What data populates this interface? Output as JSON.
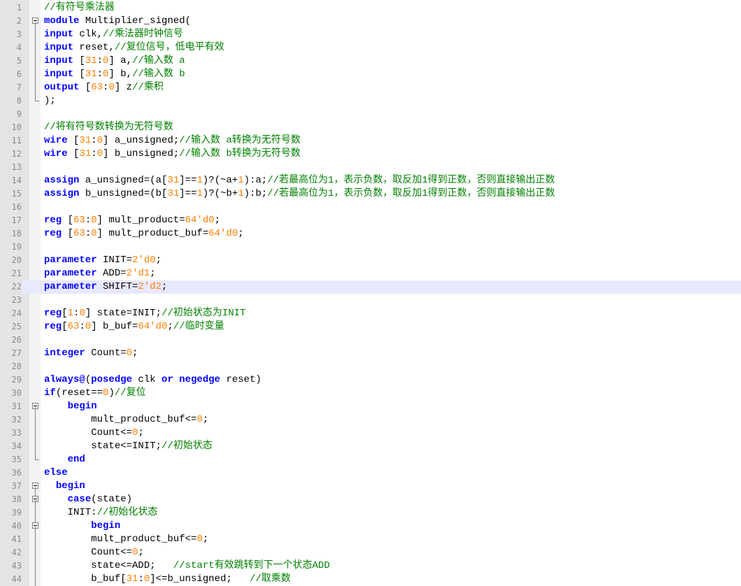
{
  "editor": {
    "current_line": 22,
    "lines": [
      {
        "n": "1",
        "fold": "",
        "tokens": [
          [
            "cm",
            "//有符号乘法器"
          ]
        ]
      },
      {
        "n": "2",
        "fold": "start",
        "tokens": [
          [
            "kw",
            "module"
          ],
          [
            "tx",
            " Multiplier_signed("
          ]
        ]
      },
      {
        "n": "3",
        "fold": "line",
        "tokens": [
          [
            "kw",
            "input"
          ],
          [
            "tx",
            " clk,"
          ],
          [
            "cm",
            "//乘法器时钟信号"
          ]
        ]
      },
      {
        "n": "4",
        "fold": "line",
        "tokens": [
          [
            "kw",
            "input"
          ],
          [
            "tx",
            " reset,"
          ],
          [
            "cm",
            "//复位信号，低电平有效"
          ]
        ]
      },
      {
        "n": "5",
        "fold": "line",
        "tokens": [
          [
            "kw",
            "input"
          ],
          [
            "tx",
            " ["
          ],
          [
            "num",
            "31"
          ],
          [
            "tx",
            ":"
          ],
          [
            "num",
            "0"
          ],
          [
            "tx",
            "] a,"
          ],
          [
            "cm",
            "//输入数 a"
          ]
        ]
      },
      {
        "n": "6",
        "fold": "line",
        "tokens": [
          [
            "kw",
            "input"
          ],
          [
            "tx",
            " ["
          ],
          [
            "num",
            "31"
          ],
          [
            "tx",
            ":"
          ],
          [
            "num",
            "0"
          ],
          [
            "tx",
            "] b,"
          ],
          [
            "cm",
            "//输入数 b"
          ]
        ]
      },
      {
        "n": "7",
        "fold": "line",
        "tokens": [
          [
            "kw",
            "output"
          ],
          [
            "tx",
            " ["
          ],
          [
            "num",
            "63"
          ],
          [
            "tx",
            ":"
          ],
          [
            "num",
            "0"
          ],
          [
            "tx",
            "] z"
          ],
          [
            "cm",
            "//乘积"
          ]
        ]
      },
      {
        "n": "8",
        "fold": "end",
        "tokens": [
          [
            "tx",
            ");"
          ]
        ]
      },
      {
        "n": "9",
        "fold": "",
        "tokens": []
      },
      {
        "n": "10",
        "fold": "",
        "tokens": [
          [
            "cm",
            "//将有符号数转换为无符号数"
          ]
        ]
      },
      {
        "n": "11",
        "fold": "",
        "tokens": [
          [
            "kw",
            "wire"
          ],
          [
            "tx",
            " ["
          ],
          [
            "num",
            "31"
          ],
          [
            "tx",
            ":"
          ],
          [
            "num",
            "0"
          ],
          [
            "tx",
            "] a_unsigned;"
          ],
          [
            "cm",
            "//输入数 a转换为无符号数"
          ]
        ]
      },
      {
        "n": "12",
        "fold": "",
        "tokens": [
          [
            "kw",
            "wire"
          ],
          [
            "tx",
            " ["
          ],
          [
            "num",
            "31"
          ],
          [
            "tx",
            ":"
          ],
          [
            "num",
            "0"
          ],
          [
            "tx",
            "] b_unsigned;"
          ],
          [
            "cm",
            "//输入数 b转换为无符号数"
          ]
        ]
      },
      {
        "n": "13",
        "fold": "",
        "tokens": []
      },
      {
        "n": "14",
        "fold": "",
        "tokens": [
          [
            "kw",
            "assign"
          ],
          [
            "tx",
            " a_unsigned=(a["
          ],
          [
            "num",
            "31"
          ],
          [
            "tx",
            "]=="
          ],
          [
            "num",
            "1"
          ],
          [
            "tx",
            ")?(~a+"
          ],
          [
            "num",
            "1"
          ],
          [
            "tx",
            "):a;"
          ],
          [
            "cm",
            "//若最高位为1，表示负数，取反加1得到正数，否则直接输出正数"
          ]
        ]
      },
      {
        "n": "15",
        "fold": "",
        "tokens": [
          [
            "kw",
            "assign"
          ],
          [
            "tx",
            " b_unsigned=(b["
          ],
          [
            "num",
            "31"
          ],
          [
            "tx",
            "]=="
          ],
          [
            "num",
            "1"
          ],
          [
            "tx",
            ")?(~b+"
          ],
          [
            "num",
            "1"
          ],
          [
            "tx",
            "):b;"
          ],
          [
            "cm",
            "//若最高位为1，表示负数，取反加1得到正数，否则直接输出正数"
          ]
        ]
      },
      {
        "n": "16",
        "fold": "",
        "tokens": []
      },
      {
        "n": "17",
        "fold": "",
        "tokens": [
          [
            "kw",
            "reg"
          ],
          [
            "tx",
            " ["
          ],
          [
            "num",
            "63"
          ],
          [
            "tx",
            ":"
          ],
          [
            "num",
            "0"
          ],
          [
            "tx",
            "] mult_product="
          ],
          [
            "num",
            "64'd0"
          ],
          [
            "tx",
            ";"
          ]
        ]
      },
      {
        "n": "18",
        "fold": "",
        "tokens": [
          [
            "kw",
            "reg"
          ],
          [
            "tx",
            " ["
          ],
          [
            "num",
            "63"
          ],
          [
            "tx",
            ":"
          ],
          [
            "num",
            "0"
          ],
          [
            "tx",
            "] mult_product_buf="
          ],
          [
            "num",
            "64'd0"
          ],
          [
            "tx",
            ";"
          ]
        ]
      },
      {
        "n": "19",
        "fold": "",
        "tokens": []
      },
      {
        "n": "20",
        "fold": "",
        "tokens": [
          [
            "kw",
            "parameter"
          ],
          [
            "tx",
            " INIT="
          ],
          [
            "num",
            "2'd0"
          ],
          [
            "tx",
            ";"
          ]
        ]
      },
      {
        "n": "21",
        "fold": "",
        "tokens": [
          [
            "kw",
            "parameter"
          ],
          [
            "tx",
            " ADD="
          ],
          [
            "num",
            "2'd1"
          ],
          [
            "tx",
            ";"
          ]
        ]
      },
      {
        "n": "22",
        "fold": "",
        "tokens": [
          [
            "kw",
            "parameter"
          ],
          [
            "tx",
            " SHIFT="
          ],
          [
            "num",
            "2'd2"
          ],
          [
            "tx",
            ";"
          ]
        ]
      },
      {
        "n": "23",
        "fold": "",
        "tokens": []
      },
      {
        "n": "24",
        "fold": "",
        "tokens": [
          [
            "kw",
            "reg"
          ],
          [
            "tx",
            "["
          ],
          [
            "num",
            "1"
          ],
          [
            "tx",
            ":"
          ],
          [
            "num",
            "0"
          ],
          [
            "tx",
            "] state=INIT;"
          ],
          [
            "cm",
            "//初始状态为INIT"
          ]
        ]
      },
      {
        "n": "25",
        "fold": "",
        "tokens": [
          [
            "kw",
            "reg"
          ],
          [
            "tx",
            "["
          ],
          [
            "num",
            "63"
          ],
          [
            "tx",
            ":"
          ],
          [
            "num",
            "0"
          ],
          [
            "tx",
            "] b_buf="
          ],
          [
            "num",
            "64'd0"
          ],
          [
            "tx",
            ";"
          ],
          [
            "cm",
            "//临时变量"
          ]
        ]
      },
      {
        "n": "26",
        "fold": "",
        "tokens": []
      },
      {
        "n": "27",
        "fold": "",
        "tokens": [
          [
            "kw",
            "integer"
          ],
          [
            "tx",
            " Count="
          ],
          [
            "num",
            "0"
          ],
          [
            "tx",
            ";"
          ]
        ]
      },
      {
        "n": "28",
        "fold": "",
        "tokens": []
      },
      {
        "n": "29",
        "fold": "",
        "tokens": [
          [
            "kw",
            "always@"
          ],
          [
            "tx",
            "("
          ],
          [
            "kw",
            "posedge"
          ],
          [
            "tx",
            " clk "
          ],
          [
            "kw",
            "or"
          ],
          [
            "tx",
            " "
          ],
          [
            "kw",
            "negedge"
          ],
          [
            "tx",
            " reset)"
          ]
        ]
      },
      {
        "n": "30",
        "fold": "",
        "tokens": [
          [
            "kw",
            "if"
          ],
          [
            "tx",
            "(reset=="
          ],
          [
            "num",
            "0"
          ],
          [
            "tx",
            ")"
          ],
          [
            "cm",
            "//复位"
          ]
        ]
      },
      {
        "n": "31",
        "fold": "start",
        "tokens": [
          [
            "tx",
            "    "
          ],
          [
            "kw",
            "begin"
          ]
        ]
      },
      {
        "n": "32",
        "fold": "line",
        "tokens": [
          [
            "tx",
            "        mult_product_buf<="
          ],
          [
            "num",
            "0"
          ],
          [
            "tx",
            ";"
          ]
        ]
      },
      {
        "n": "33",
        "fold": "line",
        "tokens": [
          [
            "tx",
            "        Count<="
          ],
          [
            "num",
            "0"
          ],
          [
            "tx",
            ";"
          ]
        ]
      },
      {
        "n": "34",
        "fold": "line",
        "tokens": [
          [
            "tx",
            "        state<=INIT;"
          ],
          [
            "cm",
            "//初始状态"
          ]
        ]
      },
      {
        "n": "35",
        "fold": "end",
        "tokens": [
          [
            "tx",
            "    "
          ],
          [
            "kw",
            "end"
          ]
        ]
      },
      {
        "n": "36",
        "fold": "",
        "tokens": [
          [
            "kw",
            "else"
          ]
        ]
      },
      {
        "n": "37",
        "fold": "start",
        "tokens": [
          [
            "tx",
            "  "
          ],
          [
            "kw",
            "begin"
          ]
        ]
      },
      {
        "n": "38",
        "fold": "startline",
        "tokens": [
          [
            "tx",
            "    "
          ],
          [
            "kw",
            "case"
          ],
          [
            "tx",
            "(state)"
          ]
        ]
      },
      {
        "n": "39",
        "fold": "line",
        "tokens": [
          [
            "tx",
            "    INIT:"
          ],
          [
            "cm",
            "//初始化状态"
          ]
        ]
      },
      {
        "n": "40",
        "fold": "startline",
        "tokens": [
          [
            "tx",
            "        "
          ],
          [
            "kw",
            "begin"
          ]
        ]
      },
      {
        "n": "41",
        "fold": "line",
        "tokens": [
          [
            "tx",
            "        mult_product_buf<="
          ],
          [
            "num",
            "0"
          ],
          [
            "tx",
            ";"
          ]
        ]
      },
      {
        "n": "42",
        "fold": "line",
        "tokens": [
          [
            "tx",
            "        Count<="
          ],
          [
            "num",
            "0"
          ],
          [
            "tx",
            ";"
          ]
        ]
      },
      {
        "n": "43",
        "fold": "line",
        "tokens": [
          [
            "tx",
            "        state<=ADD;   "
          ],
          [
            "cm",
            "//start有效跳转到下一个状态ADD"
          ]
        ]
      },
      {
        "n": "44",
        "fold": "line",
        "tokens": [
          [
            "tx",
            "        b_buf["
          ],
          [
            "num",
            "31"
          ],
          [
            "tx",
            ":"
          ],
          [
            "num",
            "0"
          ],
          [
            "tx",
            "]<=b_unsigned;   "
          ],
          [
            "cm",
            "//取乘数"
          ]
        ]
      }
    ]
  }
}
